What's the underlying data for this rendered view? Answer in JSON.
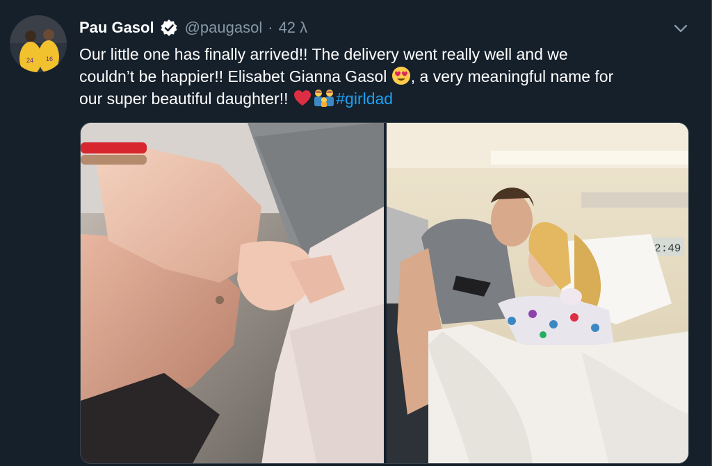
{
  "tweet": {
    "author_name": "Pau Gasol",
    "handle": "@paugasol",
    "separator": "·",
    "timestamp": "42 λ",
    "body_lines": [
      "Our little one has finally arrived!! The delivery went really well and we",
      "couldn’t be happier!! Elisabet Gianna Gasol",
      ", a very meaningful name for",
      "our super beautiful daughter!!"
    ],
    "hashtag": "#girldad",
    "emojis": [
      "heart-eyes-emoji",
      "red-heart-emoji",
      "family-emoji"
    ],
    "media": [
      {
        "alt_kind": "photo",
        "subject": "hands-with-newborn"
      },
      {
        "alt_kind": "photo",
        "subject": "couple-with-newborn-hospital"
      }
    ]
  },
  "colors": {
    "background": "#15202b",
    "text": "#ffffff",
    "secondary_text": "#8899a6",
    "link": "#1da1f2",
    "verified": "#ffffff",
    "border": "#38444d"
  }
}
